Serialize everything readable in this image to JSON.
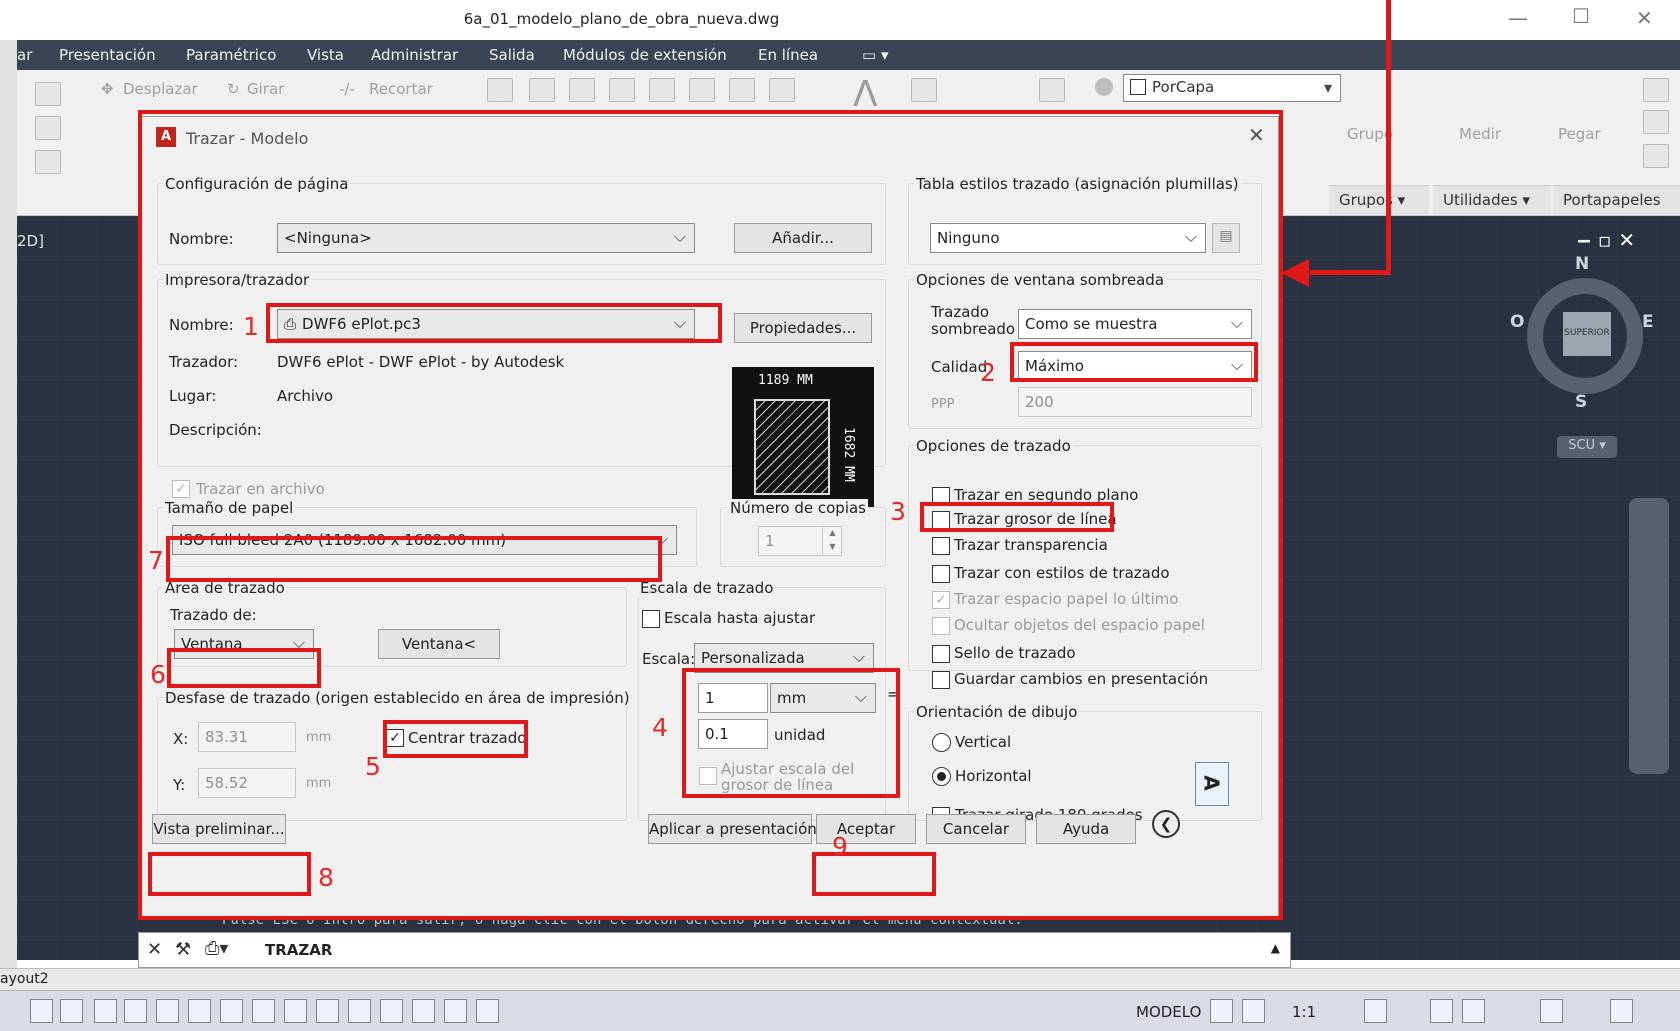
{
  "window": {
    "title": "6a_01_modelo_plano_de_obra_nueva.dwg",
    "minimize": "—",
    "maximize": "☐",
    "close": "✕"
  },
  "menu": [
    "ar",
    "Presentación",
    "Paramétrico",
    "Vista",
    "Administrar",
    "Salida",
    "Módulos de extensión",
    "En línea",
    "▭ ▾"
  ],
  "ribbon": {
    "modify": {
      "move": "Desplazar",
      "rotate": "Girar",
      "trim": "Recortar"
    },
    "layer": "PorCapa",
    "group": "Grupo",
    "groups_panel": "Grupos ▾",
    "measure": "Medir",
    "utilities_panel": "Utilidades ▾",
    "paste": "Pegar",
    "clipboard_panel": "Portapapeles"
  },
  "viewport_label": "2D]",
  "viewcube": {
    "n": "N",
    "s": "S",
    "e": "E",
    "w": "O",
    "top": "SUPERIOR",
    "ucs": "SCU ▾"
  },
  "viewport_controls": "‒ ▫ ✕",
  "command": {
    "history": "Pulse ESC o Intro para salir, o haga clic con el botón derecho para activar el menú contextual.",
    "current": "TRAZAR"
  },
  "layout_tab": "ayout2",
  "status": {
    "model": "MODELO",
    "scale": "1:1"
  },
  "dialog": {
    "title": "Trazar - Modelo",
    "close": "✕",
    "page_setup": {
      "group": "Configuración de página",
      "name_label": "Nombre:",
      "name_value": "<Ninguna>",
      "add": "Añadir..."
    },
    "printer": {
      "group": "Impresora/trazador",
      "name_label": "Nombre:",
      "name_value": "DWF6 ePlot.pc3",
      "props": "Propiedades...",
      "plotter_label": "Trazador:",
      "plotter_value": "DWF6 ePlot - DWF ePlot - by Autodesk",
      "where_label": "Lugar:",
      "where_value": "Archivo",
      "desc_label": "Descripción:",
      "to_file": "Trazar en archivo",
      "preview_w": "1189 MM",
      "preview_h": "1682 MM"
    },
    "paper": {
      "group": "Tamaño de papel",
      "value": "ISO full bleed 2A0 (1189.00 x 1682.00 mm)"
    },
    "copies": {
      "label": "Número de copias",
      "value": "1"
    },
    "area": {
      "group": "Área de trazado",
      "what_label": "Trazado de:",
      "what_value": "Ventana",
      "window_btn": "Ventana<"
    },
    "offset": {
      "group": "Desfase de trazado (origen establecido en área de impresión)",
      "x_label": "X:",
      "x_value": "83.31",
      "y_label": "Y:",
      "y_value": "58.52",
      "unit": "mm",
      "center": "Centrar trazado"
    },
    "scale": {
      "group": "Escala de trazado",
      "fit": "Escala hasta ajustar",
      "scale_label": "Escala:",
      "scale_value": "Personalizada",
      "v1": "1",
      "u1": "mm",
      "eq": "=",
      "v2": "0.1",
      "u2": "unidad",
      "lw": "Ajustar escala del grosor de línea"
    },
    "styles": {
      "group": "Tabla estilos trazado (asignación plumillas)",
      "value": "Ninguno"
    },
    "shaded": {
      "group": "Opciones de ventana sombreada",
      "shade_label": "Trazado sombreado",
      "shade_value": "Como se muestra",
      "quality_label": "Calidad",
      "quality_value": "Máximo",
      "dpi_label": "PPP",
      "dpi_value": "200"
    },
    "options": {
      "group": "Opciones de trazado",
      "items": [
        "Trazar en segundo plano",
        "Trazar grosor de línea",
        "Trazar transparencia",
        "Trazar con estilos de trazado",
        "Trazar espacio papel lo último",
        "Ocultar objetos del espacio papel",
        "Sello de trazado",
        "Guardar cambios en presentación"
      ]
    },
    "orientation": {
      "group": "Orientación de dibujo",
      "portrait": "Vertical",
      "landscape": "Horizontal",
      "upside": "Trazar girado 180 grados",
      "icon": "A"
    },
    "buttons": {
      "preview": "Vista preliminar...",
      "apply": "Aplicar a presentación",
      "ok": "Aceptar",
      "cancel": "Cancelar",
      "help": "Ayuda",
      "more": "❮"
    }
  },
  "annotations": [
    "1",
    "2",
    "3",
    "4",
    "5",
    "6",
    "7",
    "8",
    "9"
  ]
}
